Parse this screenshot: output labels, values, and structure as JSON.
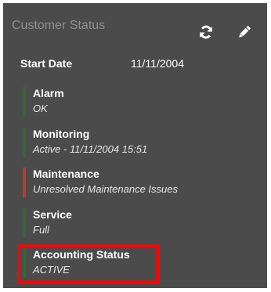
{
  "panel": {
    "title": "Customer Status",
    "refresh_icon": "refresh-icon",
    "edit_icon": "pencil-icon"
  },
  "start_date": {
    "label": "Start Date",
    "value": "11/11/2004"
  },
  "statuses": [
    {
      "label": "Alarm",
      "value": "OK",
      "color": "#2e6b2e"
    },
    {
      "label": "Monitoring",
      "value": "Active - 11/11/2004 15:51",
      "color": "#2e6b2e"
    },
    {
      "label": "Maintenance",
      "value": "Unresolved Maintenance Issues",
      "color": "#c0392b"
    },
    {
      "label": "Service",
      "value": "Full",
      "color": "#2e6b2e"
    },
    {
      "label": "Accounting Status",
      "value": "ACTIVE",
      "color": "#2e6b2e"
    }
  ],
  "colors": {
    "panel_bg": "#4b4b4b",
    "highlight": "#e10f0f"
  }
}
